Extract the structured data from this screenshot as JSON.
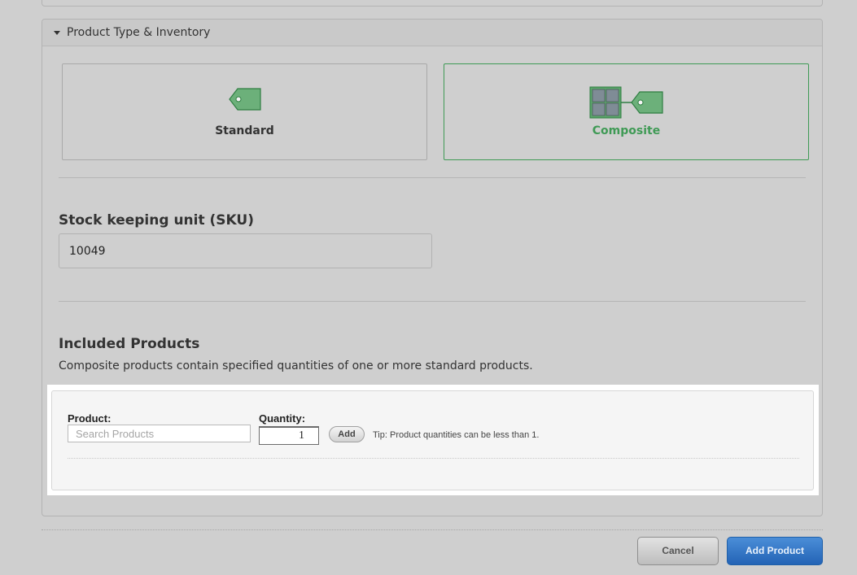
{
  "section": {
    "title": "Product Type & Inventory"
  },
  "product_types": {
    "standard_label": "Standard",
    "composite_label": "Composite",
    "selected": "Composite"
  },
  "sku": {
    "label": "Stock keeping unit (SKU)",
    "value": "10049"
  },
  "included_products": {
    "heading": "Included Products",
    "description": "Composite products contain specified quantities of one or more standard products.",
    "product_label": "Product:",
    "search_placeholder": "Search Products",
    "quantity_label": "Quantity:",
    "quantity_value": "1",
    "add_label": "Add",
    "tip": "Tip: Product quantities can be less than 1."
  },
  "footer": {
    "cancel_label": "Cancel",
    "add_product_label": "Add Product"
  },
  "colors": {
    "accent_green": "#3f9a55",
    "tag_fill": "#6cb07a",
    "primary_blue": "#2a6fc0",
    "grid_gray": "#7f8c96"
  },
  "icons": {
    "standard": "tag-icon",
    "composite": "composite-grid-tag-icon",
    "section_toggle": "caret-down-icon"
  }
}
